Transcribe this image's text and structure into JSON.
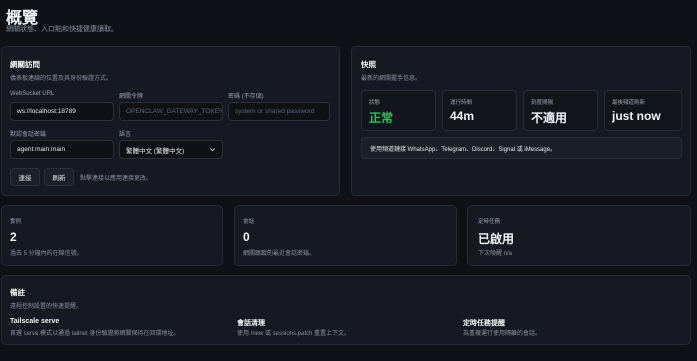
{
  "header": {
    "title": "概覽",
    "subtitle": "網關狀態、入口點和快捷健康讀取。"
  },
  "gateway_access": {
    "title": "網關訪問",
    "subtitle": "儀表板連線的位置及其身份驗證方式。",
    "websocket_url_label": "WebSocket URL",
    "websocket_url_value": "ws://localhost:18789",
    "token_label": "網關令牌",
    "token_placeholder": "OPENCLAW_GATEWAY_TOKEN",
    "password_label": "密碼 (不存儲)",
    "password_placeholder": "system or shared password",
    "session_key_label": "默認會話密鑰",
    "session_key_value": "agent:main:main",
    "language_label": "語言",
    "language_value": "繁體中文 (繁體中文)",
    "connect_button": "連接",
    "refresh_button": "刷新",
    "hint": "點擊連接以應用連接更改。"
  },
  "snapshot": {
    "title": "快照",
    "subtitle": "最新的網關握手信息。",
    "stats": [
      {
        "label": "狀態",
        "value": "正常"
      },
      {
        "label": "運行時間",
        "value": "44m"
      },
      {
        "label": "刻度間隔",
        "value": "不適用"
      },
      {
        "label": "最後頻道刷新",
        "value": "just now"
      }
    ],
    "status_color": "#22c55e",
    "banner": "使用頻道鏈接 WhatsApp、Telegram、Discord、Signal 或 iMessage。"
  },
  "metrics": {
    "instances": {
      "label": "實例",
      "value": "2",
      "sub": "過去 5 分鐘內的在線信號。"
    },
    "sessions": {
      "label": "會話",
      "value": "0",
      "sub": "網關跟蹤的最近會話密鑰。"
    },
    "cron": {
      "label": "定時任務",
      "value": "已啟用",
      "sub": "下次喚醒 n/a"
    }
  },
  "notes": {
    "title": "備註",
    "subtitle": "遠程控制設置的快速提醒。",
    "items": [
      {
        "title": "Tailscale serve",
        "text": "首選 serve 模式以通過 tailnet 身份驗證將網關保持在回環地址。"
      },
      {
        "title": "會話清理",
        "text": "使用 /new 或 sessions.patch 重置上下文。"
      },
      {
        "title": "定時任務提醒",
        "text": "為重複運行使用隔離的會話。"
      }
    ]
  }
}
